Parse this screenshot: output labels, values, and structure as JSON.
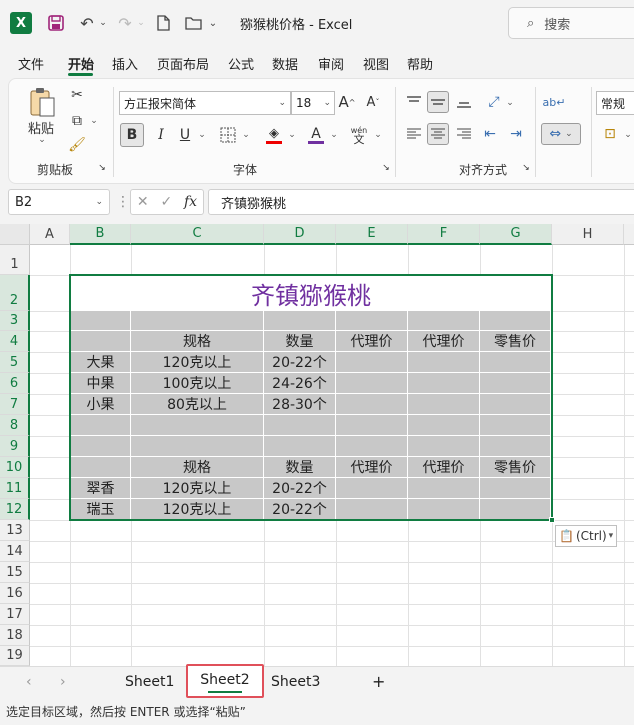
{
  "titlebar": {
    "doc_title": "猕猴桃价格  -  Excel",
    "search_placeholder": "搜索"
  },
  "menu": {
    "tabs": [
      "文件",
      "开始",
      "插入",
      "页面布局",
      "公式",
      "数据",
      "审阅",
      "视图",
      "帮助"
    ],
    "active": "开始"
  },
  "ribbon": {
    "paste_label": "粘贴",
    "clipboard_label": "剪贴板",
    "font_label": "字体",
    "align_label": "对齐方式",
    "font_name": "方正报宋简体",
    "font_size": "18",
    "number_format": "常规",
    "bold": "B",
    "italic": "I",
    "underline": "U",
    "grow_font": "A",
    "shrink_font": "A",
    "font_color": "A",
    "phonetic": "wén",
    "phonetic_char": "文"
  },
  "formula_bar": {
    "name_box": "B2",
    "formula": "齐镇猕猴桃",
    "fx_label": "fx"
  },
  "sheet": {
    "columns": [
      "A",
      "B",
      "C",
      "D",
      "E",
      "F",
      "G",
      "H"
    ],
    "rows": [
      "1",
      "2",
      "3",
      "4",
      "5",
      "6",
      "7",
      "8",
      "9",
      "10",
      "11",
      "12",
      "13",
      "14",
      "15",
      "16",
      "17",
      "18",
      "19"
    ],
    "title": "齐镇猕猴桃",
    "header": {
      "spec": "规格",
      "qty": "数量",
      "agent1": "代理价",
      "agent2": "代理价",
      "retail": "零售价"
    },
    "table1": [
      {
        "name": "大果",
        "spec": "120克以上",
        "qty": "20-22个"
      },
      {
        "name": "中果",
        "spec": "100克以上",
        "qty": "24-26个"
      },
      {
        "name": "小果",
        "spec": "80克以上",
        "qty": "28-30个"
      }
    ],
    "table2": [
      {
        "name": "翠香",
        "spec": "120克以上",
        "qty": "20-22个"
      },
      {
        "name": "瑞玉",
        "spec": "120克以上",
        "qty": "20-22个"
      }
    ],
    "paste_options": "(Ctrl)"
  },
  "tabs": {
    "sheets": [
      "Sheet1",
      "Sheet2",
      "Sheet3"
    ],
    "active": "Sheet2",
    "add": "+"
  },
  "status": {
    "text": "选定目标区域，然后按 ENTER 或选择“粘贴”"
  },
  "colors": {
    "accent": "#107c41",
    "title_purple": "#7030a0",
    "fill_gray": "#c8c8c8",
    "highlight_red": "#e0505a"
  }
}
